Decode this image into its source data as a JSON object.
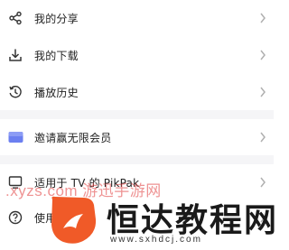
{
  "menu": {
    "items": [
      {
        "label": "我的分享",
        "icon": "share-icon"
      },
      {
        "label": "我的下载",
        "icon": "download-icon"
      },
      {
        "label": "播放历史",
        "icon": "history-icon"
      },
      {
        "label": "邀请赢无限会员",
        "icon": "invite-card-icon"
      },
      {
        "label": "适用于 TV 的 PikPak",
        "icon": "tv-icon"
      },
      {
        "label": "使用",
        "icon": "help-icon"
      }
    ]
  },
  "watermark": {
    "site_text": ".xyzs.com 游迅手游网",
    "logo_title": "恒达教程网",
    "logo_url": "www.sxhdcj.com",
    "logo_color": "#f05a28"
  },
  "colors": {
    "band": "#f5f5f7",
    "icon": "#333333",
    "invite_icon": "#6b7ff0",
    "chevron": "#b0b0b0"
  }
}
